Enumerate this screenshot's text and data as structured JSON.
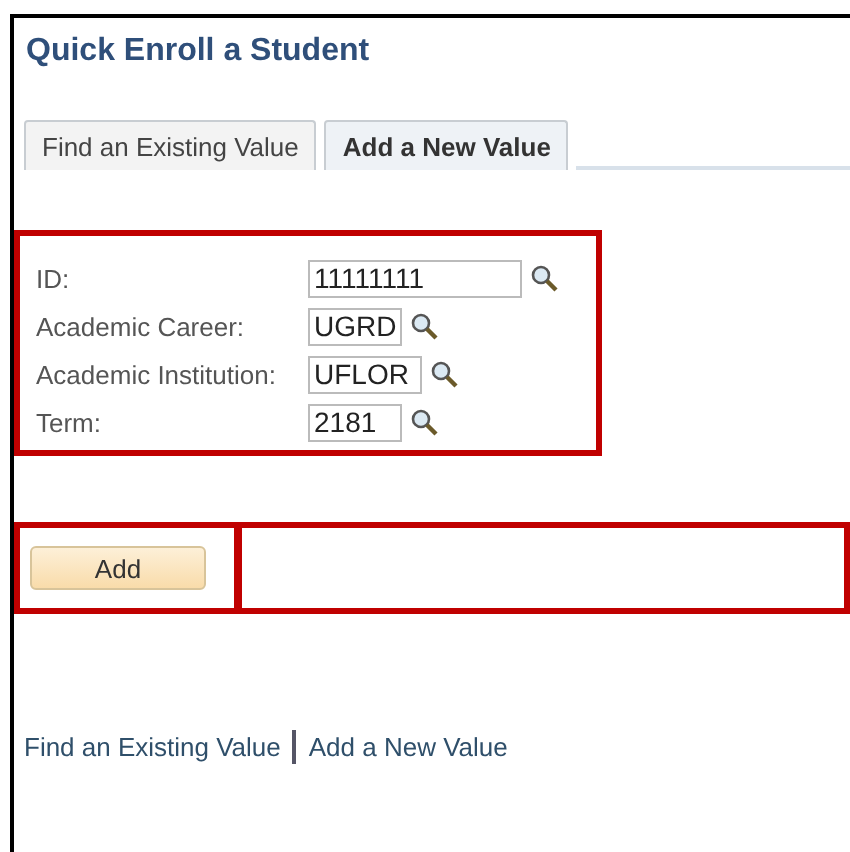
{
  "title": "Quick Enroll a Student",
  "tabs": [
    {
      "label": "Find an Existing Value",
      "selected": false
    },
    {
      "label": "Add a New Value",
      "selected": true
    }
  ],
  "fields": [
    {
      "label": "ID:",
      "value": "11111111",
      "kind": "wide"
    },
    {
      "label": "Academic Career:",
      "value": "UGRD",
      "kind": "narrow"
    },
    {
      "label": "Academic Institution:",
      "value": "UFLOR",
      "kind": "narrow"
    },
    {
      "label": "Term:",
      "value": "2181",
      "kind": "narrow"
    }
  ],
  "add_button": "Add",
  "links": [
    "Find an Existing Value",
    "Add a New Value"
  ]
}
